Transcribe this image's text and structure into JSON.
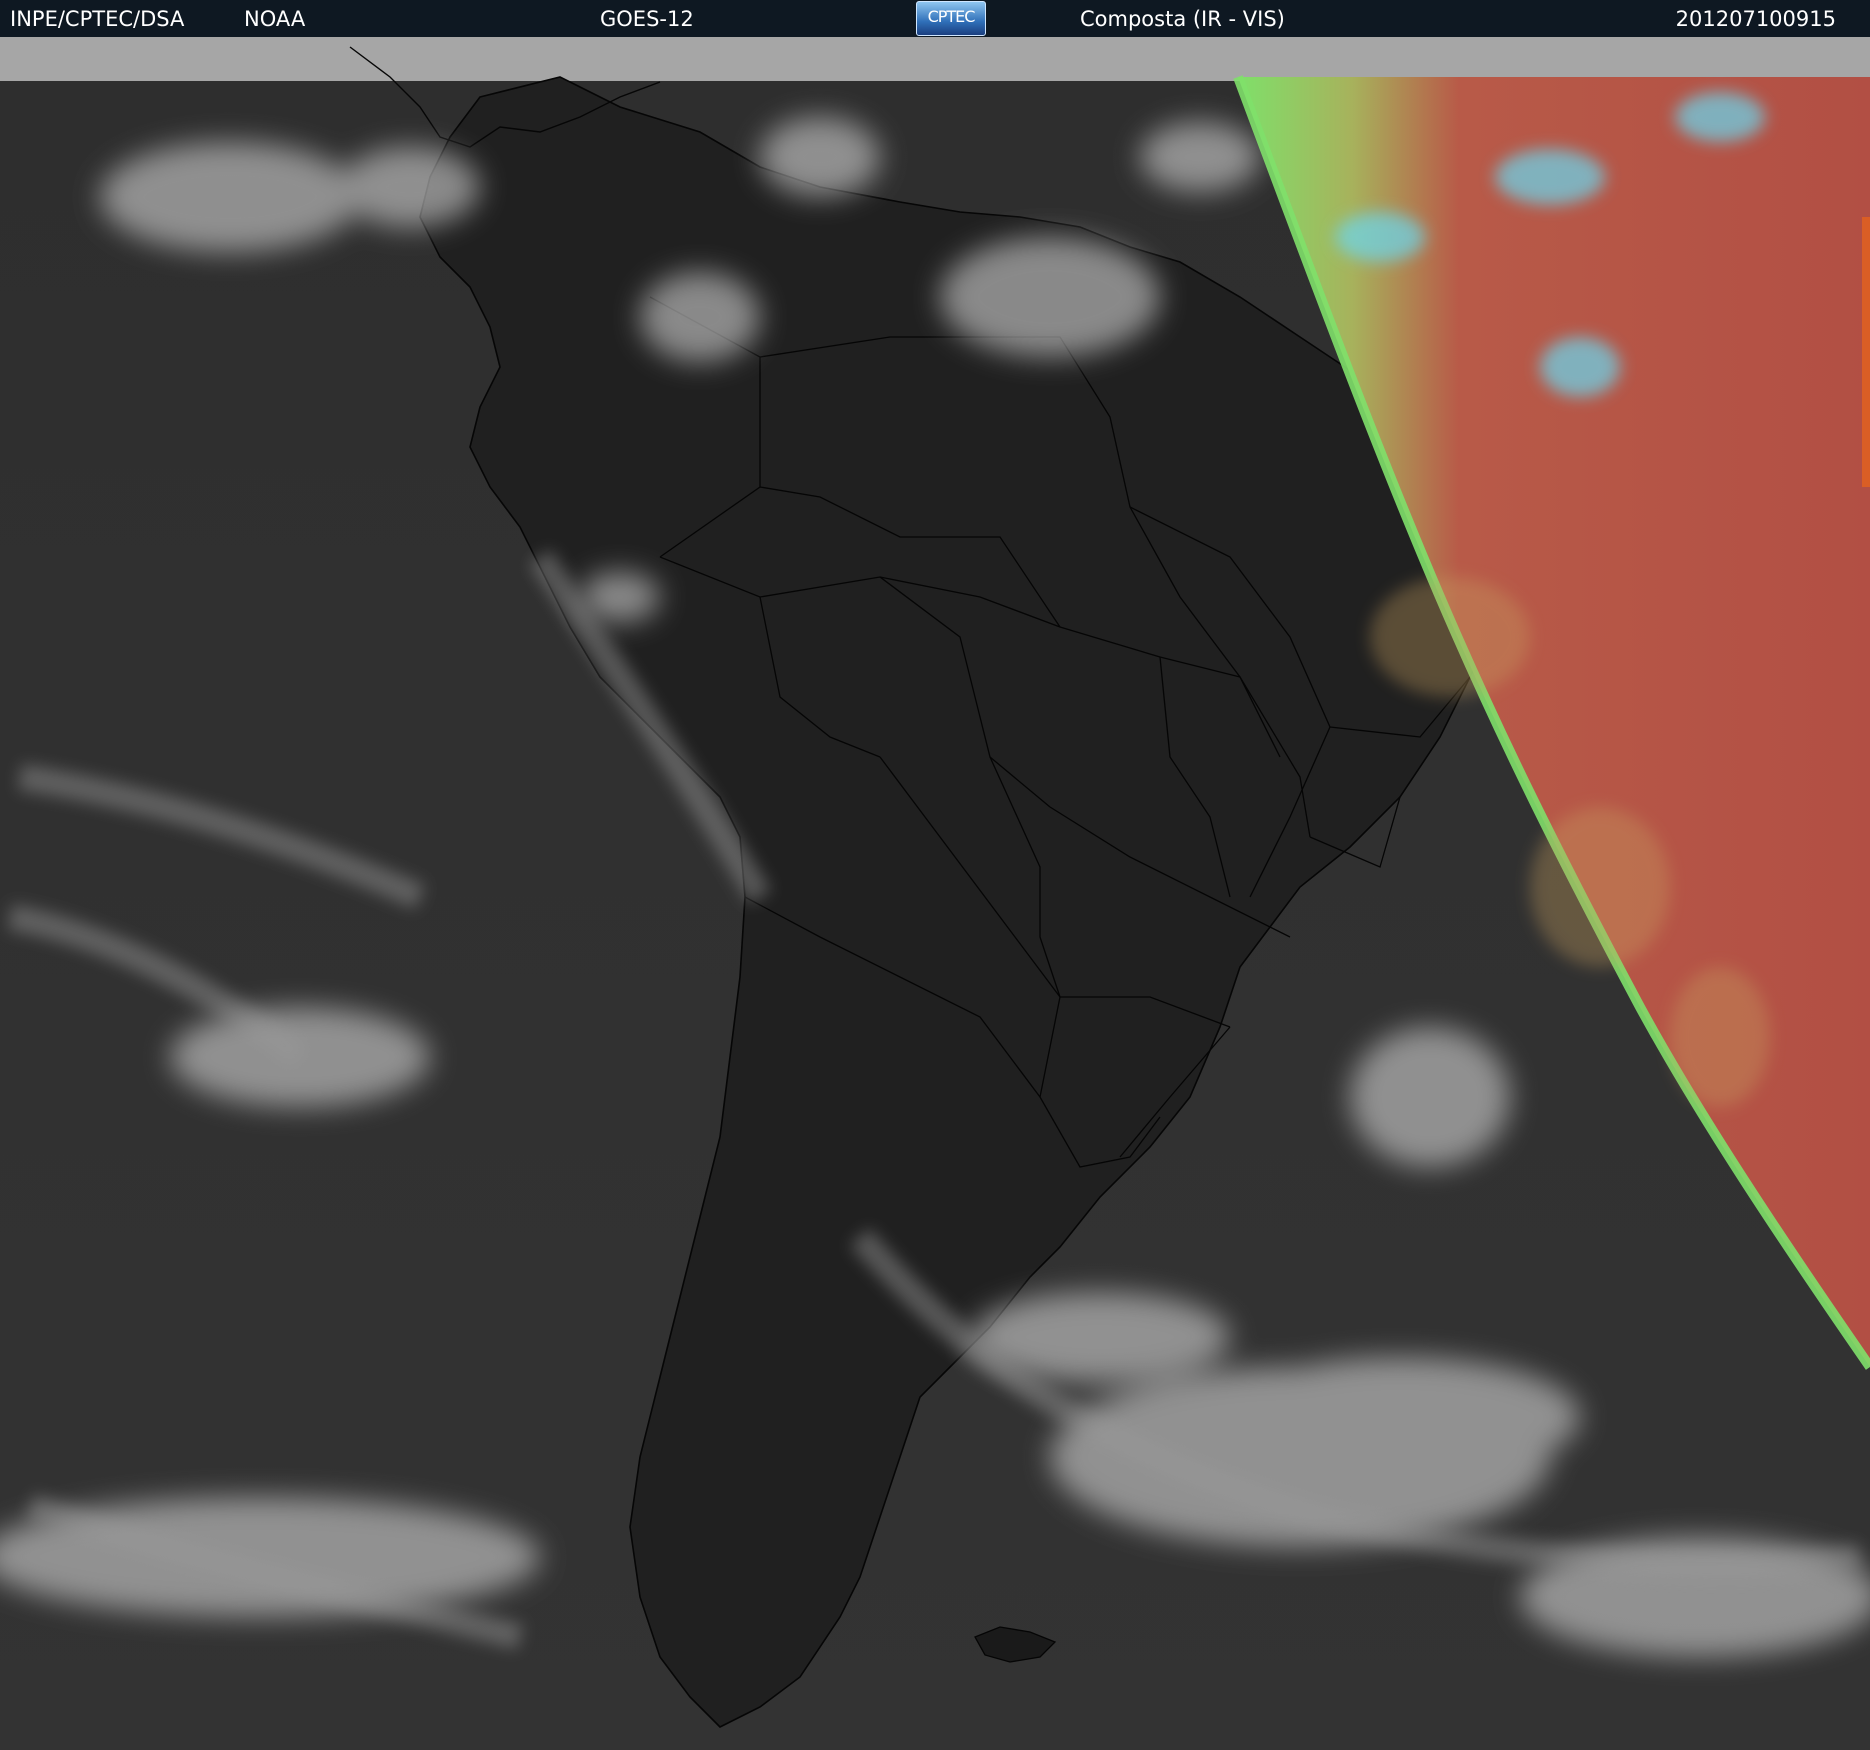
{
  "header": {
    "organization": "INPE/CPTEC/DSA",
    "agency": "NOAA",
    "satellite": "GOES-12",
    "logo_text": "CPTEC",
    "product": "Composta (IR - VIS)",
    "timestamp": "201207100915"
  },
  "colors": {
    "header_bg": "#0e1822",
    "header_text": "#ffffff",
    "ocean": "#2b2b2b",
    "land": "#1f1f1f",
    "clouds": "#c8c8c8",
    "no_data_band": "#a6a6a6",
    "vis_land": "#b85a48",
    "vis_terminator": "#7fe06a",
    "vis_clouds": "#6ad8f0",
    "borders": "#050505"
  }
}
